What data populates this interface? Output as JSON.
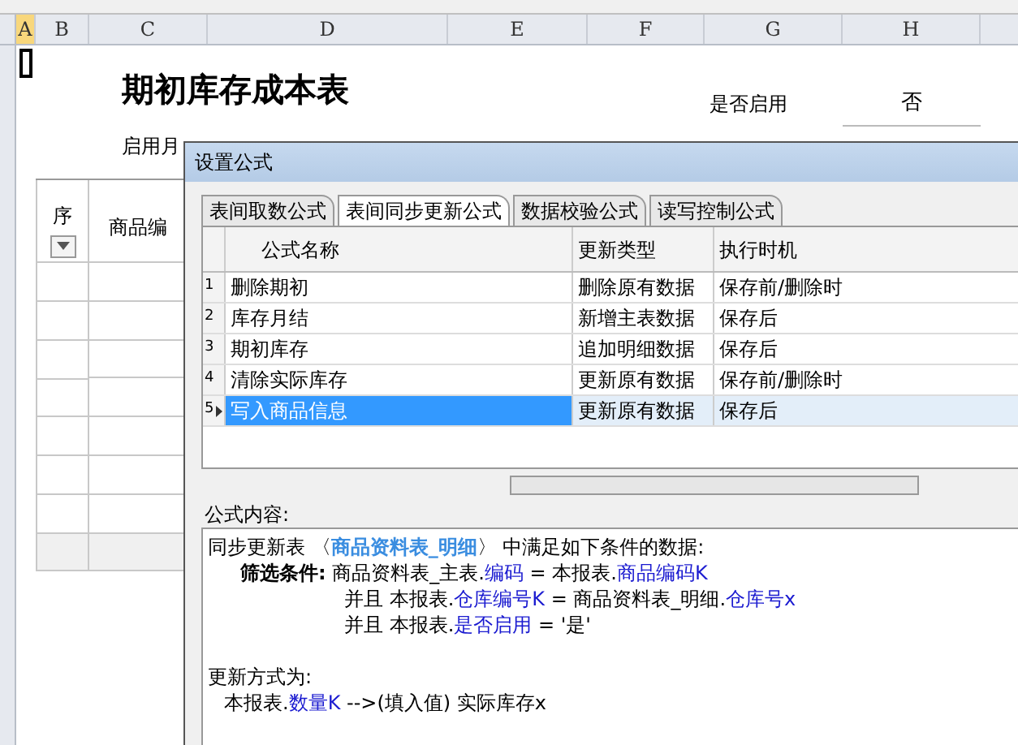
{
  "sheet": {
    "columns": [
      {
        "label": "A",
        "selected": true
      },
      {
        "label": "B",
        "selected": false
      },
      {
        "label": "C",
        "selected": false
      },
      {
        "label": "D",
        "selected": false
      },
      {
        "label": "E",
        "selected": false
      },
      {
        "label": "F",
        "selected": false
      },
      {
        "label": "G",
        "selected": false
      },
      {
        "label": "H",
        "selected": false
      }
    ],
    "title": "期初库存成本表",
    "enabled_label": "是否启用",
    "enabled_value": "否",
    "month_label": "启用月",
    "table_headers": [
      "序",
      "商品编"
    ]
  },
  "dialog": {
    "title": "设置公式",
    "tabs": [
      {
        "label": "表间取数公式",
        "selected": false
      },
      {
        "label": "表间同步更新公式",
        "selected": true
      },
      {
        "label": "数据校验公式",
        "selected": false
      },
      {
        "label": "读写控制公式",
        "selected": false
      }
    ],
    "columns": [
      "公式名称",
      "更新类型",
      "执行时机"
    ],
    "rows": [
      {
        "index": "1",
        "name": "删除期初",
        "type": "删除原有数据",
        "timing": "保存前/删除时",
        "selected": false
      },
      {
        "index": "2",
        "name": "库存月结",
        "type": "新增主表数据",
        "timing": "保存后",
        "selected": false
      },
      {
        "index": "3",
        "name": "期初库存",
        "type": "追加明细数据",
        "timing": "保存后",
        "selected": false
      },
      {
        "index": "4",
        "name": "清除实际库存",
        "type": "更新原有数据",
        "timing": "保存前/删除时",
        "selected": false
      },
      {
        "index": "5",
        "name": "写入商品信息",
        "type": "更新原有数据",
        "timing": "保存后",
        "selected": true
      }
    ],
    "content_label": "公式内容:",
    "content": [
      {
        "kind": "text",
        "parts": [
          {
            "kind": "plain",
            "text": "同步更新表 〈"
          },
          {
            "kind": "table",
            "text": "商品资料表_明细"
          },
          {
            "kind": "plain",
            "text": "〉 中满足如下条件的数据:"
          }
        ]
      },
      {
        "kind": "condition",
        "parts": [
          {
            "kind": "label",
            "text": "筛选条件:"
          },
          {
            "kind": "plain",
            "text": " 商品资料表_主表."
          },
          {
            "kind": "field",
            "text": "编码"
          },
          {
            "kind": "plain",
            "text": " = 本报表."
          },
          {
            "kind": "field",
            "text": "商品编码K"
          }
        ]
      },
      {
        "kind": "and",
        "parts": [
          {
            "kind": "plain",
            "text": "并且 本报表."
          },
          {
            "kind": "field",
            "text": "仓库编号K"
          },
          {
            "kind": "plain",
            "text": " = 商品资料表_明细."
          },
          {
            "kind": "field",
            "text": "仓库号x"
          }
        ]
      },
      {
        "kind": "and",
        "parts": [
          {
            "kind": "plain",
            "text": "并且 本报表."
          },
          {
            "kind": "field",
            "text": "是否启用"
          },
          {
            "kind": "plain",
            "text": " = '是'"
          }
        ]
      },
      {
        "kind": "blank"
      },
      {
        "kind": "text",
        "parts": [
          {
            "kind": "plain",
            "text": "更新方式为:"
          }
        ]
      },
      {
        "kind": "action",
        "parts": [
          {
            "kind": "plain",
            "text": "本报表."
          },
          {
            "kind": "field",
            "text": "数量K"
          },
          {
            "kind": "plain",
            "text": " -->(填入值) 实际库存x"
          }
        ]
      }
    ]
  }
}
